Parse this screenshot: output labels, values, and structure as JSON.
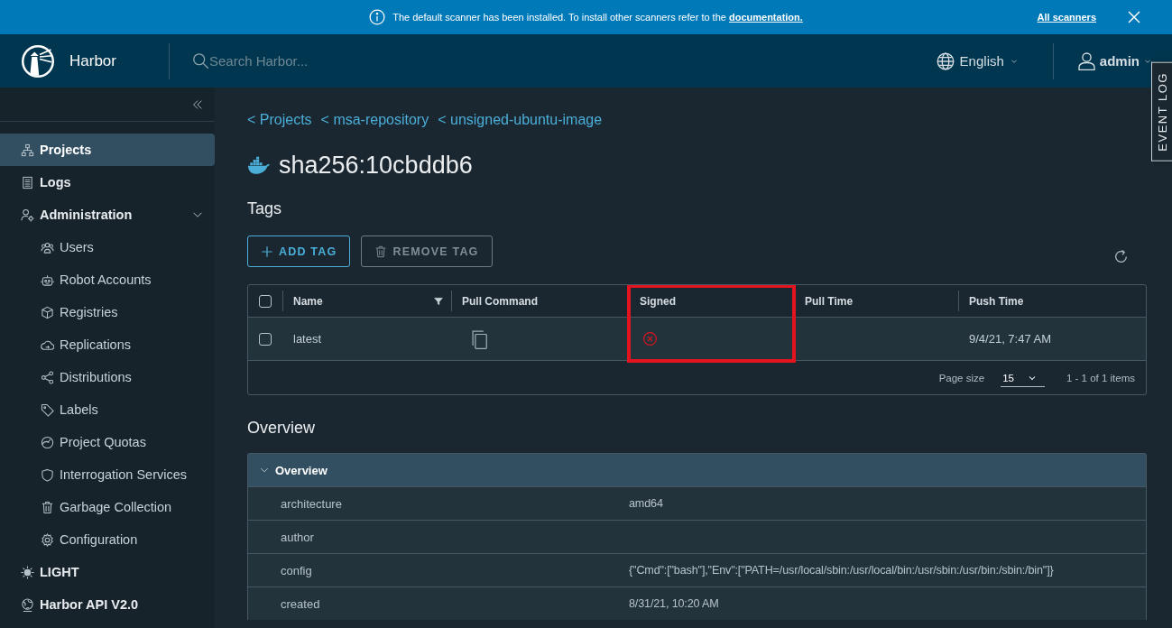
{
  "banner": {
    "message": "The default scanner has been installed. To install other scanners refer to the",
    "link": "documentation.",
    "action": "All scanners"
  },
  "header": {
    "product": "Harbor",
    "search_placeholder": "Search Harbor...",
    "language": "English",
    "user": "admin"
  },
  "sidebar": {
    "items": [
      {
        "label": "Projects",
        "selected": true
      },
      {
        "label": "Logs",
        "selected": false
      },
      {
        "label": "Administration",
        "selected": false,
        "expanded": true,
        "children": [
          {
            "label": "Users",
            "selected": false
          },
          {
            "label": "Robot Accounts",
            "selected": false
          },
          {
            "label": "Registries",
            "selected": false
          },
          {
            "label": "Replications",
            "selected": false
          },
          {
            "label": "Distributions",
            "selected": false
          },
          {
            "label": "Labels",
            "selected": false
          },
          {
            "label": "Project Quotas",
            "selected": false
          },
          {
            "label": "Interrogation Services",
            "selected": false
          },
          {
            "label": "Garbage Collection",
            "selected": false
          },
          {
            "label": "Configuration",
            "selected": false
          }
        ]
      }
    ],
    "theme_toggle": "LIGHT",
    "api_link": "Harbor API V2.0"
  },
  "breadcrumbs": [
    "< Projects",
    "< msa-repository",
    "< unsigned-ubuntu-image"
  ],
  "title": "sha256:10cbddb6",
  "tags": {
    "heading": "Tags",
    "buttons": [
      {
        "label": "ADD TAG",
        "kind": "add",
        "disabled": false
      },
      {
        "label": "REMOVE TAG",
        "kind": "remove",
        "disabled": true
      }
    ],
    "table": {
      "select_all_checked": false,
      "columns": [
        {
          "label": "Name",
          "filter": true,
          "highlighted": false
        },
        {
          "label": "Pull Command",
          "filter": false,
          "highlighted": false
        },
        {
          "label": "Signed",
          "filter": false,
          "highlighted": true
        },
        {
          "label": "Pull Time",
          "filter": false,
          "highlighted": false
        },
        {
          "label": "Push Time",
          "filter": false,
          "highlighted": false
        }
      ],
      "rows": [
        {
          "checked": false,
          "name": "latest",
          "signed": false,
          "push_time": "9/4/21, 7:47 AM"
        }
      ],
      "footer": {
        "page_size_label": "Page size",
        "page_size": "15",
        "range": "1 - 1 of 1 items"
      }
    }
  },
  "overview": {
    "heading": "Overview",
    "panel_title": "Overview",
    "expanded": true,
    "rows": [
      {
        "key": "architecture",
        "value": "amd64"
      },
      {
        "key": "author"
      },
      {
        "key": "config",
        "value": "{\"Cmd\":[\"bash\"],\"Env\":[\"PATH=/usr/local/sbin:/usr/local/bin:/usr/sbin:/usr/bin:/sbin:/bin\"]}"
      },
      {
        "key": "created",
        "value": "8/31/21, 10:20 AM"
      }
    ]
  },
  "event_log": "EVENT LOG"
}
